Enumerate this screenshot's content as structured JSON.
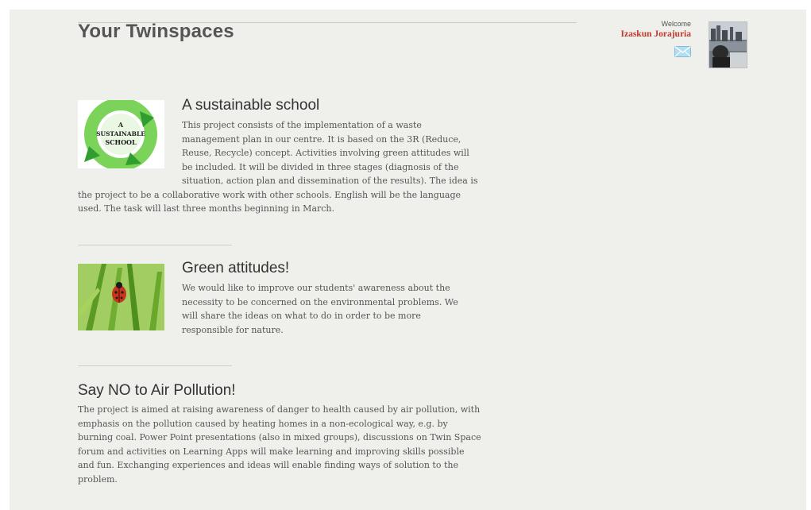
{
  "header": {
    "title": "Your Twinspaces"
  },
  "user": {
    "welcome": "Welcome",
    "name": "Izaskun Jorajuria",
    "mail_icon": "envelope-icon",
    "avatar_icon": "user-photo"
  },
  "projects": [
    {
      "title": "A sustainable school",
      "thumbnail_label": [
        "A",
        "SUSTAINABLE",
        "SCHOOL"
      ],
      "description": "This project consists of the implementation of a waste management plan in our centre. It is based on the 3R (Reduce, Reuse, Recycle) concept. Activities involving green attitudes will be included. It will be divided in three stages (diagnosis of the situation, action plan and dissemination of the results). The idea is the project to be a collaborative work with other schools. English will be the language used. The task will last three months beginning in March."
    },
    {
      "title": "Green attitudes!",
      "description": "We would like to improve our students' awareness about the necessity to be concerned on the environmental problems. We will share the ideas on what to do in order to be more responsible for nature."
    },
    {
      "title": "Say NO to Air Pollution!",
      "description": "The project is aimed at raising awareness of danger to health caused by air pollution, with emphasis on the pollution caused by heating homes in a non-ecological way, e.g. by burning coal. Power Point presentations (also in mixed groups), discussions on Twin Space forum and activities on Learning Apps will make learning and improving skills possible and fun. Exchanging experiences and ideas will enable finding ways of solution to the problem."
    }
  ],
  "colors": {
    "background": "#efefec",
    "title_text": "#555555",
    "user_name": "#c0392b",
    "body_text": "#555555"
  }
}
